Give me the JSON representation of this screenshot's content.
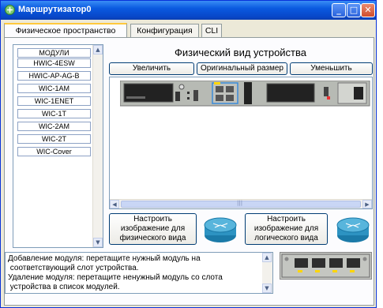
{
  "window": {
    "title": "Маршрутизатор0",
    "controls": {
      "minimize": "_",
      "maximize": "□",
      "close": "✕"
    }
  },
  "tabs": [
    {
      "label": "Физическое пространство",
      "active": true
    },
    {
      "label": "Конфигурация",
      "active": false
    },
    {
      "label": "CLI",
      "active": false
    }
  ],
  "modules": {
    "header": "МОДУЛИ",
    "items": [
      "HWIC-4ESW",
      "HWIC-AP-AG-B",
      "WIC-1AM",
      "WIC-1ENET",
      "WIC-1T",
      "WIC-2AM",
      "WIC-2T",
      "WIC-Cover"
    ]
  },
  "device_view": {
    "title": "Физический вид устройства",
    "zoom_in": "Увеличить",
    "original_size": "Оригинальный размер",
    "zoom_out": "Уменьшить",
    "hscroll_grip": "|||"
  },
  "actions": {
    "physical_label": "Настроить изображение для физического вида",
    "logical_label": "Настроить изображение для логического вида"
  },
  "description": {
    "lines": [
      "Добавление модуля: перетащите нужный модуль на",
      " соответствующий слот устройства.",
      "Удаление модуля: перетащите ненужный модуль со слота",
      " устройства в список модулей."
    ]
  },
  "colors": {
    "titlebar": "#0a5ae0",
    "tab_highlight": "#ffc83c",
    "button_border": "#003c74",
    "list_border": "#7f9db9"
  },
  "icons": [
    "router-icon",
    "router-3d-icon",
    "module-thumbnail"
  ]
}
